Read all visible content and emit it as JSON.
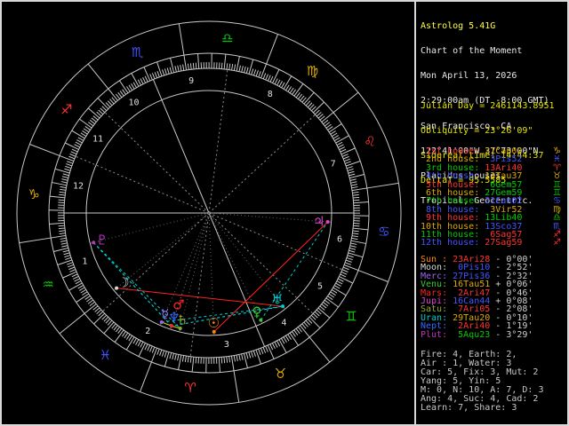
{
  "colors": {
    "fire": "#ff3333",
    "earth": "#ddaa00",
    "air": "#00cc00",
    "water": "#4455ff",
    "line": "#c8c8c8",
    "minor_cusp": "#909090",
    "pointer": "#666666",
    "house_number": "#e0e0e0",
    "stats_text": "#c8c8c8"
  },
  "sidebar": {
    "header_lines": [
      {
        "text": "Astrolog 5.41G",
        "color": "#ffff44"
      },
      {
        "text": "Chart of the Moment",
        "color": "#e8e8e8"
      },
      {
        "text": "Mon April 13, 2026",
        "color": "#e8e8e8"
      },
      {
        "text": "2:29:00am (DT -8:00 GMT)",
        "color": "#e8e8e8"
      },
      {
        "text": "San Francisco, CA",
        "color": "#e8e8e8"
      },
      {
        "text": "122°41'00\"W 37°73'00\"N",
        "color": "#e8e8e8"
      },
      {
        "text": "Placidus houses.",
        "color": "#e8e8e8"
      },
      {
        "text": "Tropical, Geocentric.",
        "color": "#e8e8e8"
      }
    ],
    "info_lines": [
      {
        "text": "Julian Day = 2461143.8951",
        "color": "#e6e600"
      },
      {
        "text": "Obliquity = 23°26'09\"",
        "color": "#e6e600"
      },
      {
        "text": "Sidereal time: 14:44:37",
        "color": "#e6e600"
      },
      {
        "text": "DeltaT = 95.5585",
        "color": "#e6e600"
      }
    ],
    "houses": [
      {
        "label": " 1st house: ",
        "value": "21Cap02",
        "glyph": "♑",
        "label_elem": "fire",
        "value_elem": "earth"
      },
      {
        "label": " 2nd house: ",
        "value": " 3Pis52",
        "glyph": "♓",
        "label_elem": "earth",
        "value_elem": "water"
      },
      {
        "label": " 3rd house: ",
        "value": "13Ari40",
        "glyph": "♈",
        "label_elem": "air",
        "value_elem": "fire"
      },
      {
        "label": " 4th house: ",
        "value": "13Tau37",
        "glyph": "♉",
        "label_elem": "water",
        "value_elem": "earth"
      },
      {
        "label": " 5th house: ",
        "value": " 6Gem57",
        "glyph": "♊",
        "label_elem": "fire",
        "value_elem": "air"
      },
      {
        "label": " 6th house: ",
        "value": "27Gem59",
        "glyph": "♊",
        "label_elem": "earth",
        "value_elem": "air"
      },
      {
        "label": " 7th house: ",
        "value": "21Can02",
        "glyph": "♋",
        "label_elem": "air",
        "value_elem": "water"
      },
      {
        "label": " 8th house: ",
        "value": " 3Vir52",
        "glyph": "♍",
        "label_elem": "water",
        "value_elem": "earth"
      },
      {
        "label": " 9th house: ",
        "value": "13Lib40",
        "glyph": "♎",
        "label_elem": "fire",
        "value_elem": "air"
      },
      {
        "label": "10th house: ",
        "value": "13Sco37",
        "glyph": "♏",
        "label_elem": "earth",
        "value_elem": "water"
      },
      {
        "label": "11th house: ",
        "value": " 6Sag57",
        "glyph": "♐",
        "label_elem": "air",
        "value_elem": "fire"
      },
      {
        "label": "12th house: ",
        "value": "27Sag59",
        "glyph": "♐",
        "label_elem": "water",
        "value_elem": "fire"
      }
    ],
    "planets": [
      {
        "label": "Sun : ",
        "value": "23Ari28",
        "speed": " - 0°00'",
        "label_color": "#ff8800",
        "value_elem": "fire"
      },
      {
        "label": "Moon: ",
        "value": " 0Pis10",
        "speed": " - 2°52'",
        "label_color": "#d8d8d8",
        "value_elem": "water"
      },
      {
        "label": "Merc: ",
        "value": "27Pis36",
        "speed": " - 2°32'",
        "label_color": "#9966ee",
        "value_elem": "water"
      },
      {
        "label": "Venu: ",
        "value": "16Tau51",
        "speed": " + 0°06'",
        "label_color": "#33cc33",
        "value_elem": "earth"
      },
      {
        "label": "Mars: ",
        "value": " 2Ari47",
        "speed": " - 0°46'",
        "label_color": "#ff2222",
        "value_elem": "fire"
      },
      {
        "label": "Jupi: ",
        "value": "16Can44",
        "speed": " + 0°08'",
        "label_color": "#dd44cc",
        "value_elem": "water"
      },
      {
        "label": "Satu: ",
        "value": " 7Ari05",
        "speed": " - 2°08'",
        "label_color": "#8faa30",
        "value_elem": "fire"
      },
      {
        "label": "Uran: ",
        "value": "29Tau20",
        "speed": " - 0°10'",
        "label_color": "#00cccc",
        "value_elem": "earth"
      },
      {
        "label": "Nept: ",
        "value": " 2Ari40",
        "speed": " - 1°19'",
        "label_color": "#3366ff",
        "value_elem": "fire"
      },
      {
        "label": "Plut: ",
        "value": " 5Aqu23",
        "speed": " - 3°29'",
        "label_color": "#bb33bb",
        "value_elem": "air"
      }
    ],
    "stats_lines": [
      "Fire: 4, Earth: 2,",
      "Air : 1, Water: 3",
      "Car: 5, Fix: 3, Mut: 2",
      "Yang: 5, Yin: 5",
      "M: 0, N: 10, A: 7, D: 3",
      "Ang: 4, Suc: 4, Cad: 2",
      "Learn: 7, Share: 3"
    ]
  },
  "wheel": {
    "ascendant_lon": 291.03,
    "signs": [
      {
        "name": "aries",
        "glyph": "♈",
        "lon_mid": 15,
        "elem": "fire"
      },
      {
        "name": "taurus",
        "glyph": "♉",
        "lon_mid": 45,
        "elem": "earth"
      },
      {
        "name": "gemini",
        "glyph": "♊",
        "lon_mid": 75,
        "elem": "air"
      },
      {
        "name": "cancer",
        "glyph": "♋",
        "lon_mid": 105,
        "elem": "water"
      },
      {
        "name": "leo",
        "glyph": "♌",
        "lon_mid": 135,
        "elem": "fire"
      },
      {
        "name": "virgo",
        "glyph": "♍",
        "lon_mid": 165,
        "elem": "earth"
      },
      {
        "name": "libra",
        "glyph": "♎",
        "lon_mid": 195,
        "elem": "air"
      },
      {
        "name": "scorpio",
        "glyph": "♏",
        "lon_mid": 225,
        "elem": "water"
      },
      {
        "name": "sagittarius",
        "glyph": "♐",
        "lon_mid": 255,
        "elem": "fire"
      },
      {
        "name": "capricorn",
        "glyph": "♑",
        "lon_mid": 285,
        "elem": "earth"
      },
      {
        "name": "aquarius",
        "glyph": "♒",
        "lon_mid": 315,
        "elem": "air"
      },
      {
        "name": "pisces",
        "glyph": "♓",
        "lon_mid": 345,
        "elem": "water"
      }
    ],
    "house_cusps": [
      291.03,
      333.87,
      13.67,
      43.62,
      66.95,
      87.98,
      111.03,
      153.87,
      193.67,
      223.62,
      246.95,
      267.98
    ],
    "planets": [
      {
        "name": "sun",
        "glyph": "☉",
        "lon": 23.47,
        "color": "#ff8800"
      },
      {
        "name": "moon",
        "glyph": "☽",
        "lon": 330.17,
        "color": "#d8d8d8"
      },
      {
        "name": "mercury",
        "glyph": "☿",
        "lon": 357.6,
        "color": "#9966ee"
      },
      {
        "name": "venus",
        "glyph": "♀",
        "lon": 46.85,
        "color": "#33cc33"
      },
      {
        "name": "mars",
        "glyph": "♂",
        "lon": 2.78,
        "color": "#ff2222"
      },
      {
        "name": "jupiter",
        "glyph": "♃",
        "lon": 106.73,
        "color": "#dd44cc"
      },
      {
        "name": "saturn",
        "glyph": "♄",
        "lon": 7.08,
        "color": "#8faa30"
      },
      {
        "name": "uranus",
        "glyph": "♅",
        "lon": 59.33,
        "color": "#00cccc"
      },
      {
        "name": "neptune",
        "glyph": "♆",
        "lon": 2.67,
        "color": "#3366ff"
      },
      {
        "name": "pluto",
        "glyph": "♇",
        "lon": 305.38,
        "color": "#bb33bb"
      }
    ],
    "aspects": [
      {
        "a": "sun",
        "b": "jupiter",
        "type": "square",
        "color": "#ff2222",
        "dashed": false
      },
      {
        "a": "moon",
        "b": "uranus",
        "type": "square",
        "color": "#ff2222",
        "dashed": false
      },
      {
        "a": "mercury",
        "b": "uranus",
        "type": "sextile",
        "color": "#00cccc",
        "dashed": true
      },
      {
        "a": "venus",
        "b": "jupiter",
        "type": "sextile",
        "color": "#00cccc",
        "dashed": true
      },
      {
        "a": "pluto",
        "b": "mars",
        "type": "sextile",
        "color": "#00cccc",
        "dashed": true
      },
      {
        "a": "pluto",
        "b": "neptune",
        "type": "sextile",
        "color": "#00cccc",
        "dashed": true
      },
      {
        "a": "pluto",
        "b": "saturn",
        "type": "sextile",
        "color": "#00cccc",
        "dashed": true
      },
      {
        "a": "uranus",
        "b": "neptune",
        "type": "sextile",
        "color": "#00cccc",
        "dashed": true
      },
      {
        "a": "uranus",
        "b": "mars",
        "type": "sextile",
        "color": "#00cccc",
        "dashed": true
      },
      {
        "a": "mars",
        "b": "neptune",
        "type": "conjunction",
        "color": "#cccc00",
        "dashed": false
      },
      {
        "a": "mars",
        "b": "saturn",
        "type": "conjunction",
        "color": "#cccc00",
        "dashed": false
      },
      {
        "a": "neptune",
        "b": "saturn",
        "type": "conjunction",
        "color": "#cccc00",
        "dashed": false
      },
      {
        "a": "mercury",
        "b": "neptune",
        "type": "conjunction",
        "color": "#cccc00",
        "dashed": false
      },
      {
        "a": "mercury",
        "b": "mars",
        "type": "conjunction",
        "color": "#cccc00",
        "dashed": false
      }
    ]
  }
}
